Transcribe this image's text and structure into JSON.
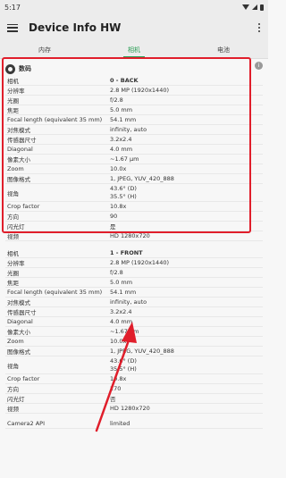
{
  "status": {
    "time": "5:17"
  },
  "appbar": {
    "title": "Device Info HW"
  },
  "tabs": [
    {
      "label": "内存",
      "active": false
    },
    {
      "label": "相机",
      "active": true
    },
    {
      "label": "电池",
      "active": false
    }
  ],
  "section": {
    "title": "数码"
  },
  "back_camera": {
    "rows": [
      {
        "key": "相机",
        "value": "0 - BACK"
      },
      {
        "key": "分辨率",
        "value": "2.8 MP (1920x1440)"
      },
      {
        "key": "光圈",
        "value": "f/2.8"
      },
      {
        "key": "焦距",
        "value": "5.0 mm"
      },
      {
        "key": "Focal length (equivalent 35 mm)",
        "value": "54.1 mm"
      },
      {
        "key": "对焦模式",
        "value": "infinity, auto"
      },
      {
        "key": "传感器尺寸",
        "value": "3.2x2.4"
      },
      {
        "key": "Diagonal",
        "value": "4.0 mm"
      },
      {
        "key": "像素大小",
        "value": "~1.67 μm"
      },
      {
        "key": "Zoom",
        "value": "10.0x"
      },
      {
        "key": "图像格式",
        "value": "1, JPEG, YUV_420_888"
      },
      {
        "key": "视角",
        "value": "43.6° (D)",
        "value2": "35.5° (H)"
      },
      {
        "key": "Crop factor",
        "value": "10.8x"
      },
      {
        "key": "方向",
        "value": "90"
      },
      {
        "key": "闪光灯",
        "value": "是"
      },
      {
        "key": "视频",
        "value": "HD 1280x720"
      }
    ]
  },
  "front_camera": {
    "rows": [
      {
        "key": "相机",
        "value": "1 - FRONT"
      },
      {
        "key": "分辨率",
        "value": "2.8 MP (1920x1440)"
      },
      {
        "key": "光圈",
        "value": "f/2.8"
      },
      {
        "key": "焦距",
        "value": "5.0 mm"
      },
      {
        "key": "Focal length (equivalent 35 mm)",
        "value": "54.1 mm"
      },
      {
        "key": "对焦模式",
        "value": "infinity, auto"
      },
      {
        "key": "传感器尺寸",
        "value": "3.2x2.4"
      },
      {
        "key": "Diagonal",
        "value": "4.0 mm"
      },
      {
        "key": "像素大小",
        "value": "~1.67 μm"
      },
      {
        "key": "Zoom",
        "value": "10.0x"
      },
      {
        "key": "图像格式",
        "value": "1, JPEG, YUV_420_888"
      },
      {
        "key": "视角",
        "value": "43.6° (D)",
        "value2": "35.5° (H)"
      },
      {
        "key": "Crop factor",
        "value": "10.8x"
      },
      {
        "key": "方向",
        "value": "270"
      },
      {
        "key": "闪光灯",
        "value": "否"
      },
      {
        "key": "视频",
        "value": "HD 1280x720"
      }
    ]
  },
  "api": {
    "key": "Camera2 API",
    "value": "limited"
  },
  "colors": {
    "accent": "#2a9d55",
    "annotation": "#e01e2b"
  }
}
